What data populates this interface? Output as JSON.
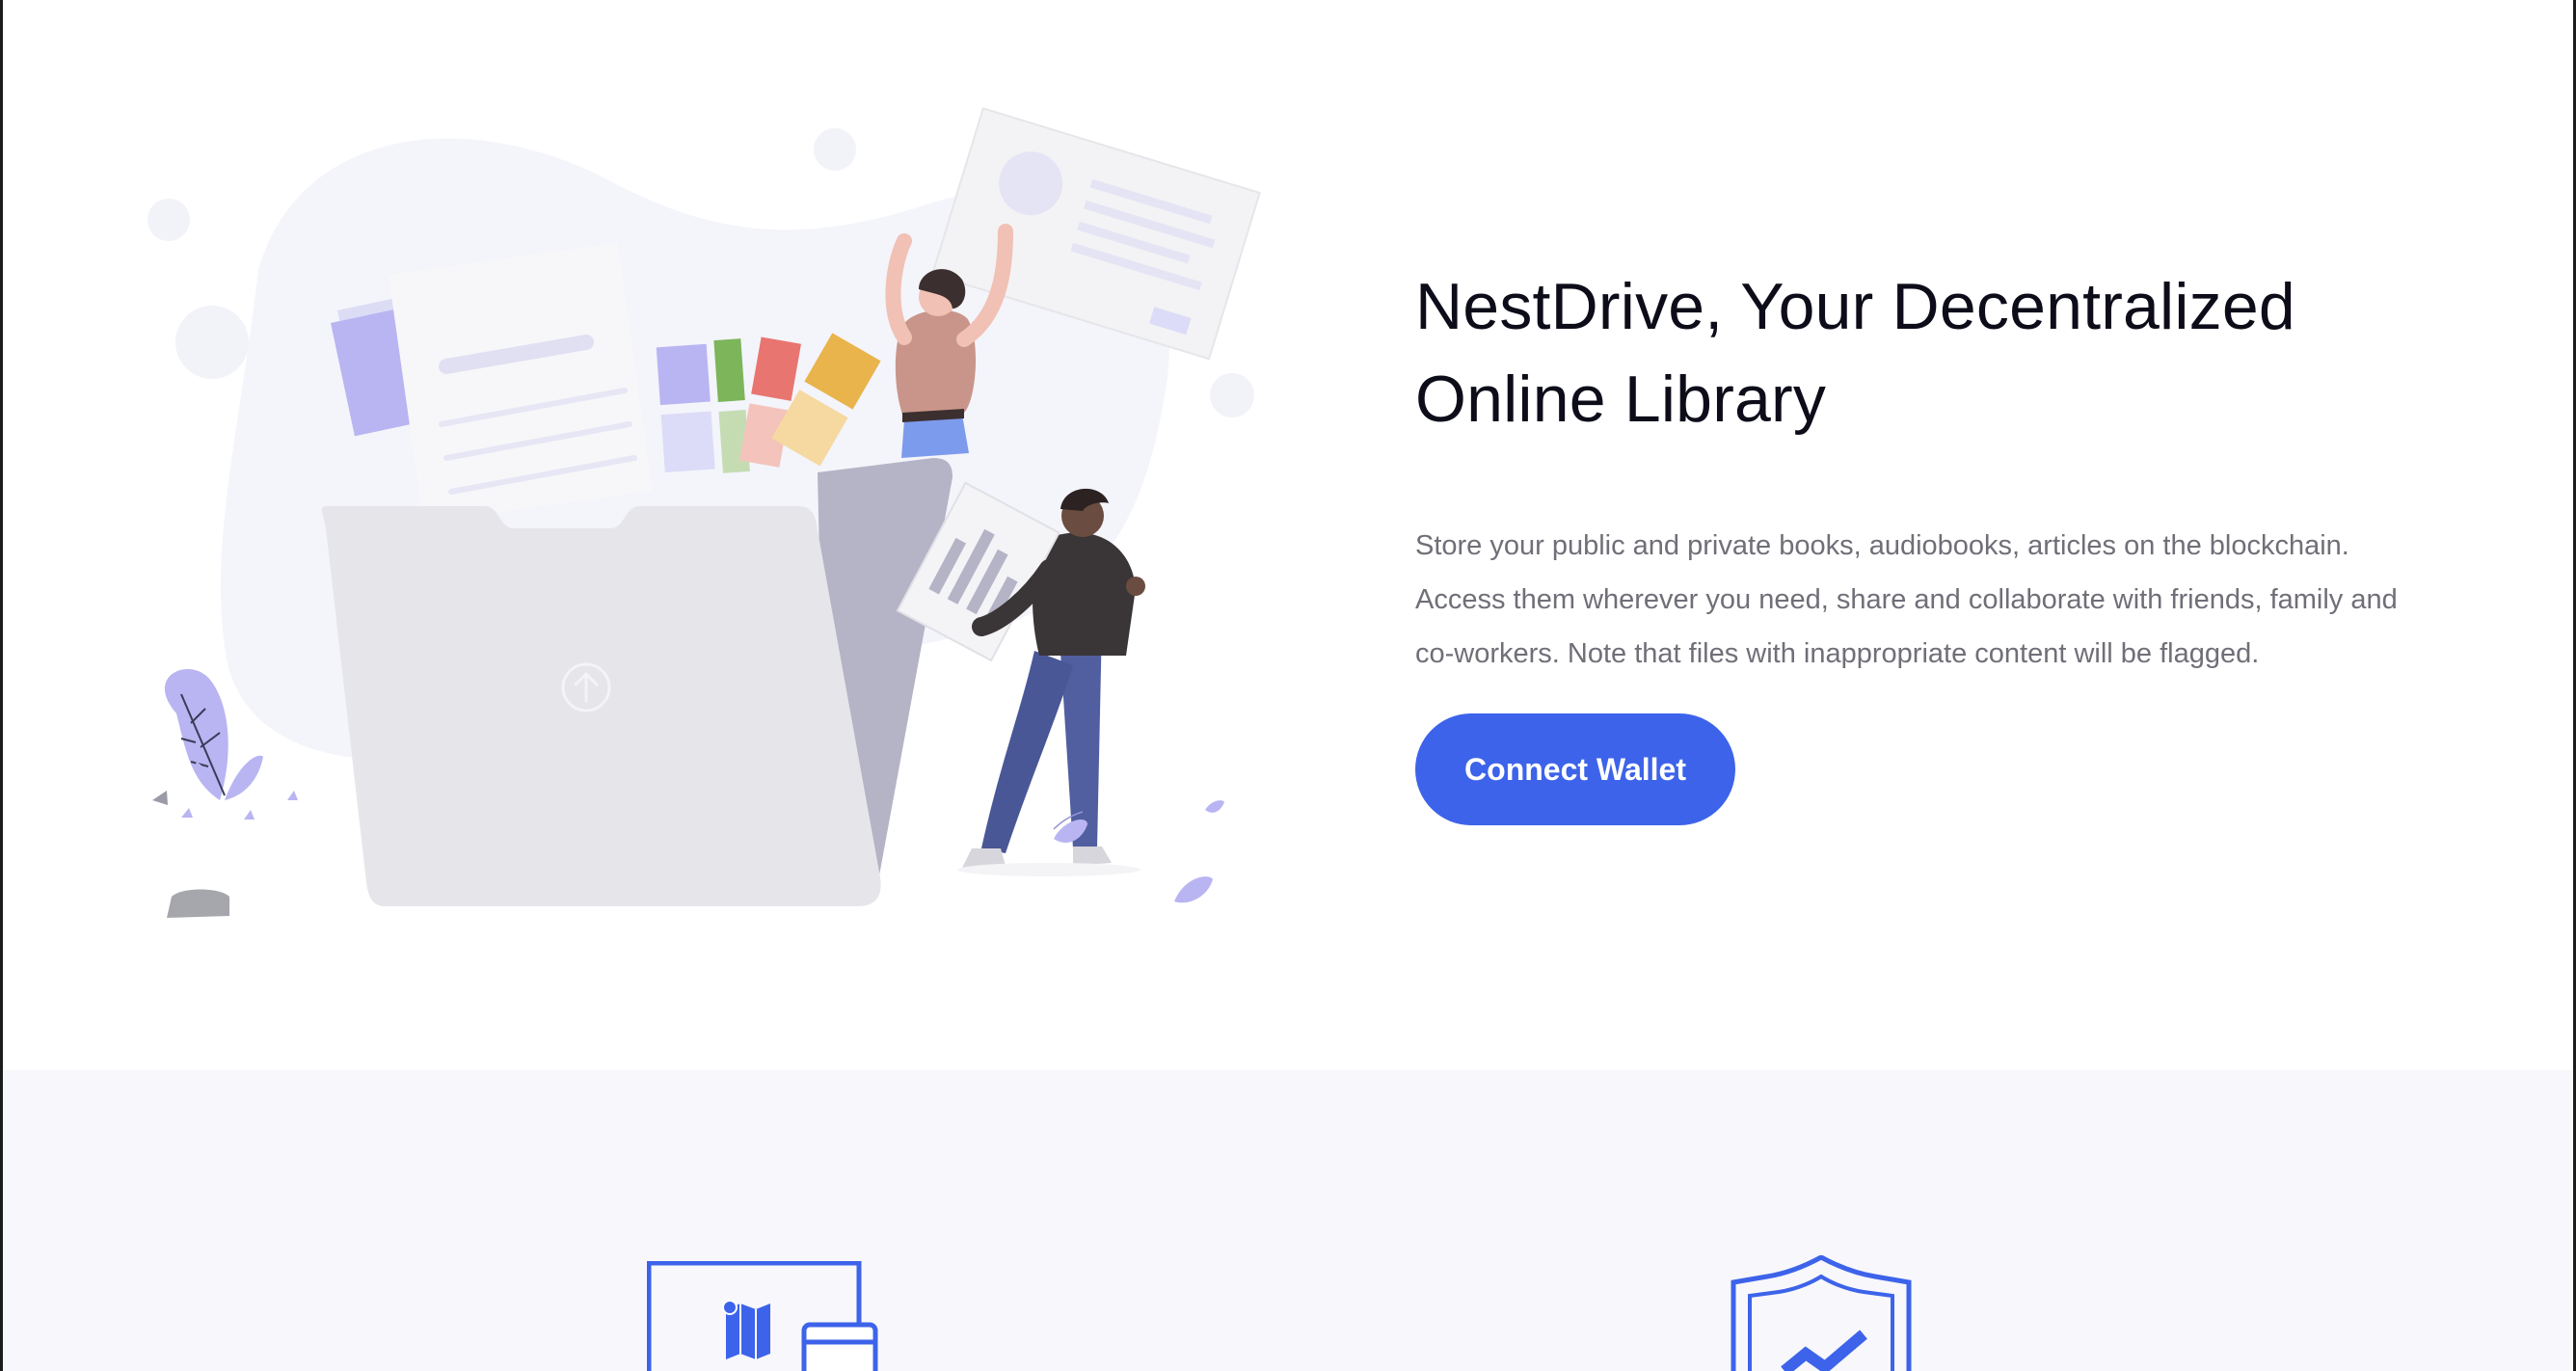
{
  "hero": {
    "title": "NestDrive, Your Decentralized\nOnline Library",
    "description": "Store your public and private books, audiobooks, articles on the blockchain.\nAccess them wherever you need, share and collaborate with friends, family and\nco-workers. Note that files with inappropriate content will be flagged.",
    "connect_button_label": "Connect Wallet",
    "illustration_icon": "file-upload-illustration"
  },
  "features": {
    "icons": [
      "map-browser-icon",
      "shield-check-icon"
    ]
  },
  "colors": {
    "accent": "#3d63ea",
    "title": "#0d0d1a",
    "body_text": "#6f6f78",
    "features_bg": "#f7f7fc",
    "illustration_purple": "#b9b5f2"
  }
}
